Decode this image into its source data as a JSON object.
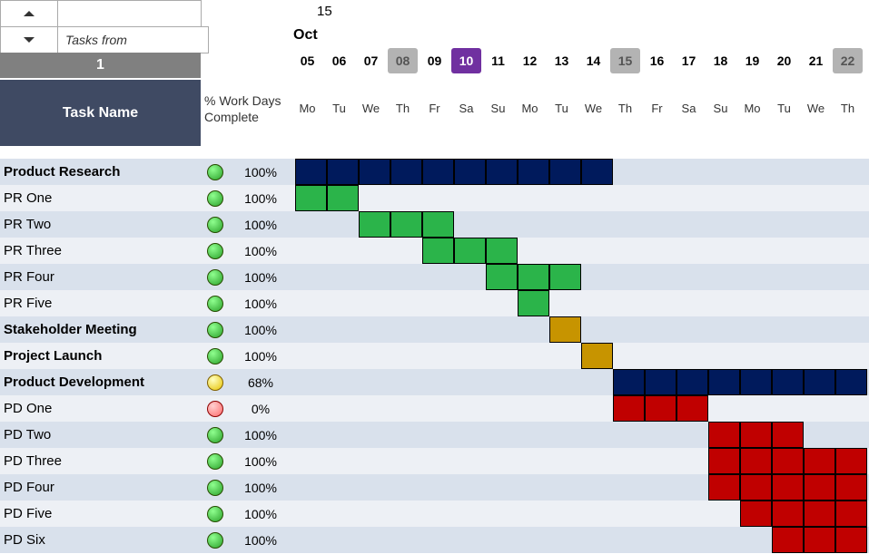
{
  "controls": {
    "tasks_from_label": "Tasks from",
    "nav_value": "1"
  },
  "timeline": {
    "top_number": "15",
    "month": "Oct",
    "days": [
      {
        "num": "05",
        "dow": "Mo",
        "weekend": false,
        "current": false
      },
      {
        "num": "06",
        "dow": "Tu",
        "weekend": false,
        "current": false
      },
      {
        "num": "07",
        "dow": "We",
        "weekend": false,
        "current": false
      },
      {
        "num": "08",
        "dow": "Th",
        "weekend": true,
        "current": false
      },
      {
        "num": "09",
        "dow": "Fr",
        "weekend": false,
        "current": false
      },
      {
        "num": "10",
        "dow": "Sa",
        "weekend": false,
        "current": true
      },
      {
        "num": "11",
        "dow": "Su",
        "weekend": false,
        "current": false
      },
      {
        "num": "12",
        "dow": "Mo",
        "weekend": false,
        "current": false
      },
      {
        "num": "13",
        "dow": "Tu",
        "weekend": false,
        "current": false
      },
      {
        "num": "14",
        "dow": "We",
        "weekend": false,
        "current": false
      },
      {
        "num": "15",
        "dow": "Th",
        "weekend": true,
        "current": false
      },
      {
        "num": "16",
        "dow": "Fr",
        "weekend": false,
        "current": false
      },
      {
        "num": "17",
        "dow": "Sa",
        "weekend": false,
        "current": false
      },
      {
        "num": "18",
        "dow": "Su",
        "weekend": false,
        "current": false
      },
      {
        "num": "19",
        "dow": "Mo",
        "weekend": false,
        "current": false
      },
      {
        "num": "20",
        "dow": "Tu",
        "weekend": false,
        "current": false
      },
      {
        "num": "21",
        "dow": "We",
        "weekend": false,
        "current": false
      },
      {
        "num": "22",
        "dow": "Th",
        "weekend": true,
        "current": false
      }
    ]
  },
  "headers": {
    "task_name": "Task Name",
    "pct_line1": "% Work Days",
    "pct_line2": "Complete"
  },
  "tasks": [
    {
      "name": "Product Research",
      "bold": true,
      "status": "green",
      "pct": "100%",
      "bar": {
        "color": "navy",
        "start": 0,
        "end": 9
      }
    },
    {
      "name": "PR One",
      "bold": false,
      "status": "green",
      "pct": "100%",
      "bar": {
        "color": "green",
        "start": 0,
        "end": 1
      }
    },
    {
      "name": "PR Two",
      "bold": false,
      "status": "green",
      "pct": "100%",
      "bar": {
        "color": "green",
        "start": 2,
        "end": 4
      }
    },
    {
      "name": "PR Three",
      "bold": false,
      "status": "green",
      "pct": "100%",
      "bar": {
        "color": "green",
        "start": 4,
        "end": 6
      }
    },
    {
      "name": "PR Four",
      "bold": false,
      "status": "green",
      "pct": "100%",
      "bar": {
        "color": "green",
        "start": 6,
        "end": 8
      }
    },
    {
      "name": "PR Five",
      "bold": false,
      "status": "green",
      "pct": "100%",
      "bar": {
        "color": "green",
        "start": 7,
        "end": 7
      }
    },
    {
      "name": "Stakeholder Meeting",
      "bold": true,
      "status": "green",
      "pct": "100%",
      "bar": {
        "color": "gold",
        "start": 8,
        "end": 8
      }
    },
    {
      "name": "Project Launch",
      "bold": true,
      "status": "green",
      "pct": "100%",
      "bar": {
        "color": "gold",
        "start": 9,
        "end": 9
      }
    },
    {
      "name": "Product Development",
      "bold": true,
      "status": "yellow",
      "pct": "68%",
      "bar": {
        "color": "navy",
        "start": 10,
        "end": 17
      }
    },
    {
      "name": "PD One",
      "bold": false,
      "status": "red",
      "pct": "0%",
      "bar": {
        "color": "red",
        "start": 10,
        "end": 12
      }
    },
    {
      "name": "PD Two",
      "bold": false,
      "status": "green",
      "pct": "100%",
      "bar": {
        "color": "red",
        "start": 13,
        "end": 15
      }
    },
    {
      "name": "PD Three",
      "bold": false,
      "status": "green",
      "pct": "100%",
      "bar": {
        "color": "red",
        "start": 13,
        "end": 17
      }
    },
    {
      "name": "PD Four",
      "bold": false,
      "status": "green",
      "pct": "100%",
      "bar": {
        "color": "red",
        "start": 13,
        "end": 17
      }
    },
    {
      "name": "PD Five",
      "bold": false,
      "status": "green",
      "pct": "100%",
      "bar": {
        "color": "red",
        "start": 14,
        "end": 17
      }
    },
    {
      "name": "PD Six",
      "bold": false,
      "status": "green",
      "pct": "100%",
      "bar": {
        "color": "red",
        "start": 15,
        "end": 17
      }
    }
  ],
  "chart_data": {
    "type": "gantt",
    "title": "",
    "x_axis": {
      "unit": "day",
      "start": "Oct 05",
      "end": "Oct 22"
    },
    "categories": [
      "05",
      "06",
      "07",
      "08",
      "09",
      "10",
      "11",
      "12",
      "13",
      "14",
      "15",
      "16",
      "17",
      "18",
      "19",
      "20",
      "21",
      "22"
    ],
    "series": [
      {
        "name": "Product Research",
        "start": "05",
        "end": "14",
        "pct_complete": 100,
        "status": "green",
        "group": true
      },
      {
        "name": "PR One",
        "start": "05",
        "end": "06",
        "pct_complete": 100,
        "status": "green"
      },
      {
        "name": "PR Two",
        "start": "07",
        "end": "09",
        "pct_complete": 100,
        "status": "green"
      },
      {
        "name": "PR Three",
        "start": "09",
        "end": "11",
        "pct_complete": 100,
        "status": "green"
      },
      {
        "name": "PR Four",
        "start": "11",
        "end": "13",
        "pct_complete": 100,
        "status": "green"
      },
      {
        "name": "PR Five",
        "start": "12",
        "end": "12",
        "pct_complete": 100,
        "status": "green"
      },
      {
        "name": "Stakeholder Meeting",
        "start": "13",
        "end": "13",
        "pct_complete": 100,
        "status": "green",
        "group": true
      },
      {
        "name": "Project Launch",
        "start": "14",
        "end": "14",
        "pct_complete": 100,
        "status": "green",
        "group": true
      },
      {
        "name": "Product Development",
        "start": "15",
        "end": "22",
        "pct_complete": 68,
        "status": "yellow",
        "group": true
      },
      {
        "name": "PD One",
        "start": "15",
        "end": "17",
        "pct_complete": 0,
        "status": "red"
      },
      {
        "name": "PD Two",
        "start": "18",
        "end": "20",
        "pct_complete": 100,
        "status": "green"
      },
      {
        "name": "PD Three",
        "start": "18",
        "end": "22",
        "pct_complete": 100,
        "status": "green"
      },
      {
        "name": "PD Four",
        "start": "18",
        "end": "22",
        "pct_complete": 100,
        "status": "green"
      },
      {
        "name": "PD Five",
        "start": "19",
        "end": "22",
        "pct_complete": 100,
        "status": "green"
      },
      {
        "name": "PD Six",
        "start": "20",
        "end": "22",
        "pct_complete": 100,
        "status": "green"
      }
    ]
  }
}
